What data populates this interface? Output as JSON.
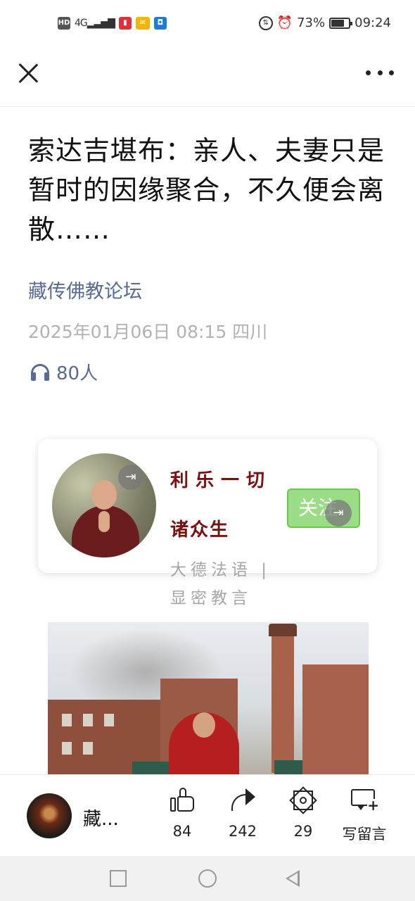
{
  "status_bar": {
    "hd": "HD",
    "signal": "4G",
    "battery_percent": "73%",
    "battery_level": 0.73,
    "time": "09:24"
  },
  "nav": {
    "close_icon": "close-icon",
    "more_icon": "more-icon"
  },
  "article": {
    "title": "索达吉堪布：亲人、夫妻只是暂时的因缘聚合，不久便会离散……",
    "account_name": "藏传佛教论坛",
    "meta": "2025年01月06日 08:15  四川",
    "listeners": "80人"
  },
  "profile_card": {
    "name_line1": "利乐一切",
    "name_line2": "诸众生",
    "description": "大德法语 | 显密教言",
    "follow_label": "关注"
  },
  "action_bar": {
    "account_short": "藏...",
    "like_count": "84",
    "share_count": "242",
    "star_count": "29",
    "comment_label": "写留言"
  },
  "colors": {
    "link": "#576b95",
    "card_name": "#7a1010",
    "follow_bg": "#9bdc86"
  }
}
